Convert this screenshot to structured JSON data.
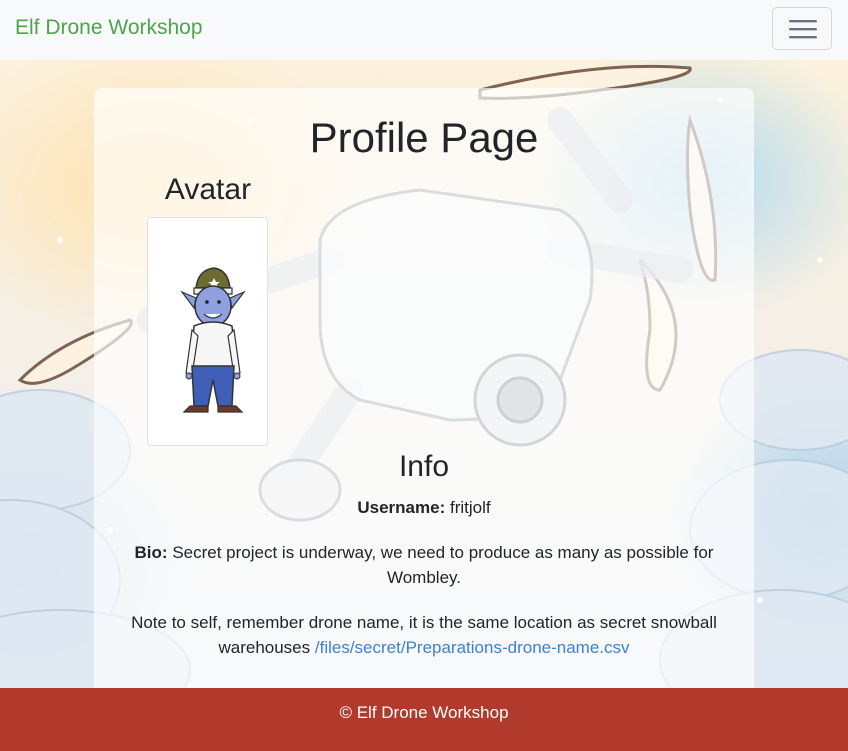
{
  "navbar": {
    "brand": "Elf Drone Workshop",
    "toggle_icon": "hamburger-menu-icon"
  },
  "profile": {
    "title": "Profile Page",
    "avatar_heading": "Avatar",
    "info_heading": "Info",
    "username_label": "Username:",
    "username": "fritjolf",
    "bio_label": "Bio:",
    "bio": "Secret project is underway, we need to produce as many as possible for Wombley.",
    "note": "Note to self, remember drone name, it is the same location as secret snowball warehouses",
    "note_link": "/files/secret/Preparations-drone-name.csv"
  },
  "colors": {
    "brand": "#4fa34a",
    "footer_bg": "#b13a2c",
    "link": "#3b82d6"
  },
  "footer": {
    "text": "© Elf Drone Workshop"
  }
}
